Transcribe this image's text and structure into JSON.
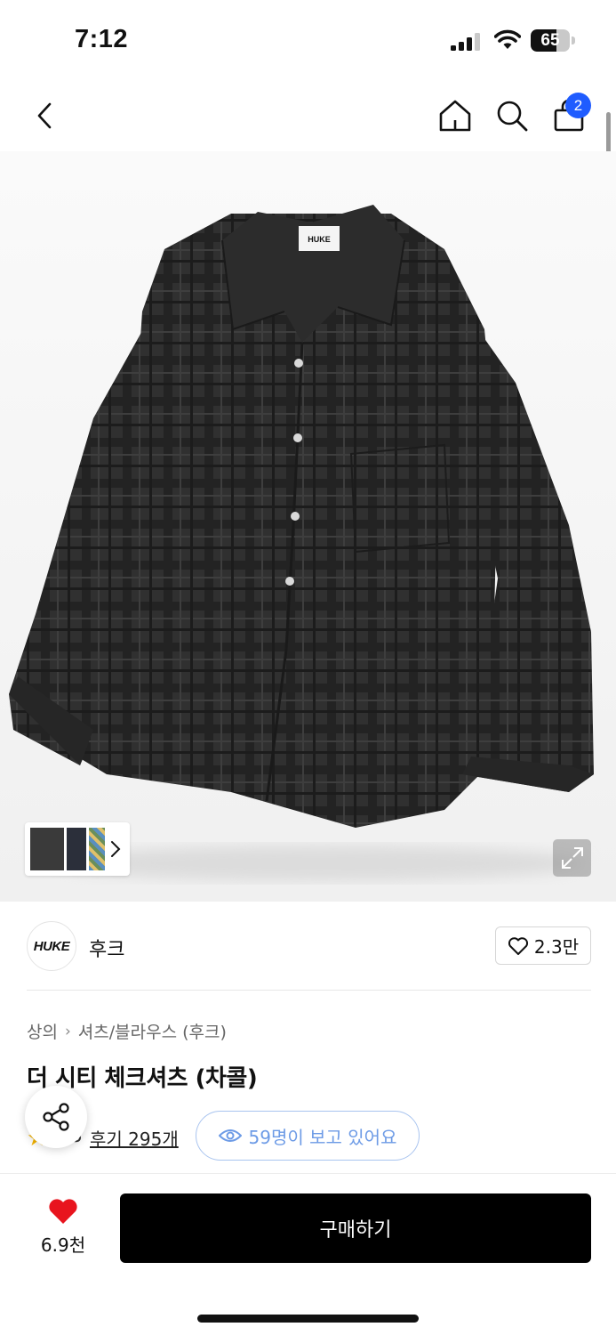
{
  "status_bar": {
    "time": "7:12",
    "battery": "65",
    "battery_level": 0.65
  },
  "nav": {
    "cart_count": "2"
  },
  "gallery": {
    "thumbnails": [
      "thumb-charcoal-front",
      "thumb-navy",
      "thumb-pattern"
    ]
  },
  "brand": {
    "logo_text": "HUKE",
    "name": "후크",
    "likes": "2.3만"
  },
  "breadcrumb": {
    "category": "상의",
    "subcategory": "셔츠/블라우스 (후크)"
  },
  "product": {
    "title": "더 시티 체크셔츠 (차콜)",
    "rating_partial": "5",
    "review_link": "후기 295개",
    "viewers": "59명이 보고 있어요"
  },
  "bottom": {
    "wish_count": "6.9천",
    "buy_label": "구매하기"
  },
  "colors": {
    "accent_blue": "#1f5cff",
    "heart_red": "#e8141e",
    "pill_blue": "#6d9be6"
  }
}
